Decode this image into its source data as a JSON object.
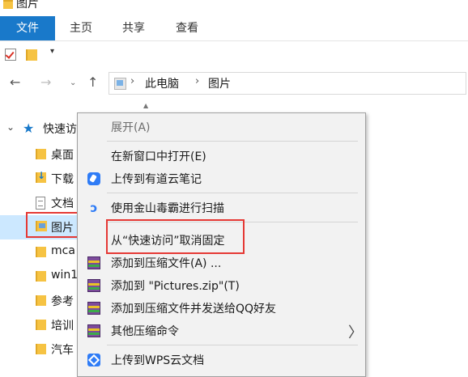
{
  "window": {
    "title": "图片"
  },
  "ribbon": {
    "tabs": [
      "文件",
      "主页",
      "共享",
      "查看"
    ]
  },
  "quick_toolbar": {
    "dropdown_glyph": "▾"
  },
  "navigation": {
    "path": [
      "此电脑",
      "图片"
    ],
    "back_glyph": "←",
    "forward_glyph": "→",
    "recent_glyph": "⌄",
    "up_glyph": "↑"
  },
  "nav_pane": {
    "items": [
      {
        "label": "快速访",
        "icon": "star-icon"
      },
      {
        "label": "桌面",
        "icon": "folder-icon"
      },
      {
        "label": "下载",
        "icon": "download-folder-icon"
      },
      {
        "label": "文档",
        "icon": "document-icon"
      },
      {
        "label": "图片",
        "icon": "pictures-folder-icon",
        "selected": true
      },
      {
        "label": "mca",
        "icon": "folder-icon"
      },
      {
        "label": "win1",
        "icon": "folder-icon"
      },
      {
        "label": "参考",
        "icon": "folder-icon"
      },
      {
        "label": "培训",
        "icon": "folder-icon"
      },
      {
        "label": "汽车",
        "icon": "folder-icon"
      }
    ]
  },
  "context_menu": {
    "items": [
      {
        "label": "展开(A)",
        "disabled": true
      },
      {
        "label": "在新窗口中打开(E)"
      },
      {
        "label": "上传到有道云笔记",
        "icon": "youdao-note-icon"
      },
      {
        "label": "使用金山毒霸进行扫描",
        "icon": "kingsoft-antivirus-icon"
      },
      {
        "label": "从“快速访问”取消固定",
        "highlighted": true
      },
      {
        "label": "添加到压缩文件(A) ...",
        "icon": "winrar-icon"
      },
      {
        "label": "添加到 \"Pictures.zip\"(T)",
        "icon": "winrar-icon"
      },
      {
        "label": "添加到压缩文件并发送给QQ好友",
        "icon": "winrar-icon"
      },
      {
        "label": "其他压缩命令",
        "icon": "winrar-icon",
        "submenu": true
      },
      {
        "label": "上传到WPS云文档",
        "icon": "wps-cloud-icon"
      }
    ],
    "submenu_glyph": "〉"
  },
  "colors": {
    "accent": "#1979ca",
    "highlight_box": "#e53935",
    "menu_bg": "#f2f2f2",
    "selection": "#cce8ff"
  }
}
